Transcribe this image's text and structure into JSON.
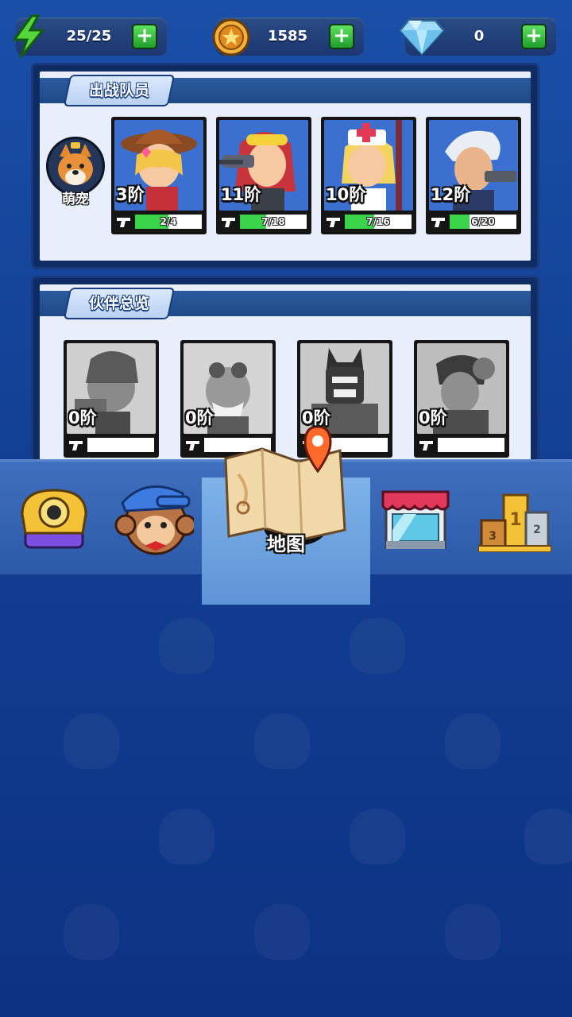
{
  "resources": {
    "energy": {
      "icon": "lightning-icon",
      "value": "25/25"
    },
    "coins": {
      "icon": "coin-icon",
      "value": "1585"
    },
    "gems": {
      "icon": "diamond-icon",
      "value": "0"
    }
  },
  "team_panel": {
    "title": "出战队员",
    "pet": {
      "label": "萌宠",
      "icon": "corgi-pet-icon"
    },
    "members": [
      {
        "name": "cowgirl",
        "tier": "3阶",
        "progress": "2/4",
        "fraction": 0.5
      },
      {
        "name": "sniper-girl",
        "tier": "11阶",
        "progress": "7/18",
        "fraction": 0.39
      },
      {
        "name": "nurse",
        "tier": "10阶",
        "progress": "7/16",
        "fraction": 0.44
      },
      {
        "name": "old-gunner",
        "tier": "12阶",
        "progress": "6/20",
        "fraction": 0.3
      }
    ]
  },
  "partners_panel": {
    "title": "伙伴总览",
    "partners": [
      {
        "name": "locked-partner-1",
        "tier": "0阶"
      },
      {
        "name": "locked-partner-2",
        "tier": "0阶"
      },
      {
        "name": "locked-partner-3",
        "tier": "0阶"
      },
      {
        "name": "locked-partner-4",
        "tier": "0阶"
      }
    ]
  },
  "nav": {
    "items": [
      {
        "icon": "gold-cannon-icon"
      },
      {
        "icon": "character-face-icon"
      },
      {
        "icon": "map-icon",
        "label": "地图",
        "active": true
      },
      {
        "icon": "shop-icon"
      },
      {
        "icon": "podium-icon"
      }
    ]
  },
  "colors": {
    "background": "#123f93",
    "progress_green": "#39d44a",
    "plus_green": "#2fbf3a",
    "panel_bg": "#e8eefb"
  }
}
